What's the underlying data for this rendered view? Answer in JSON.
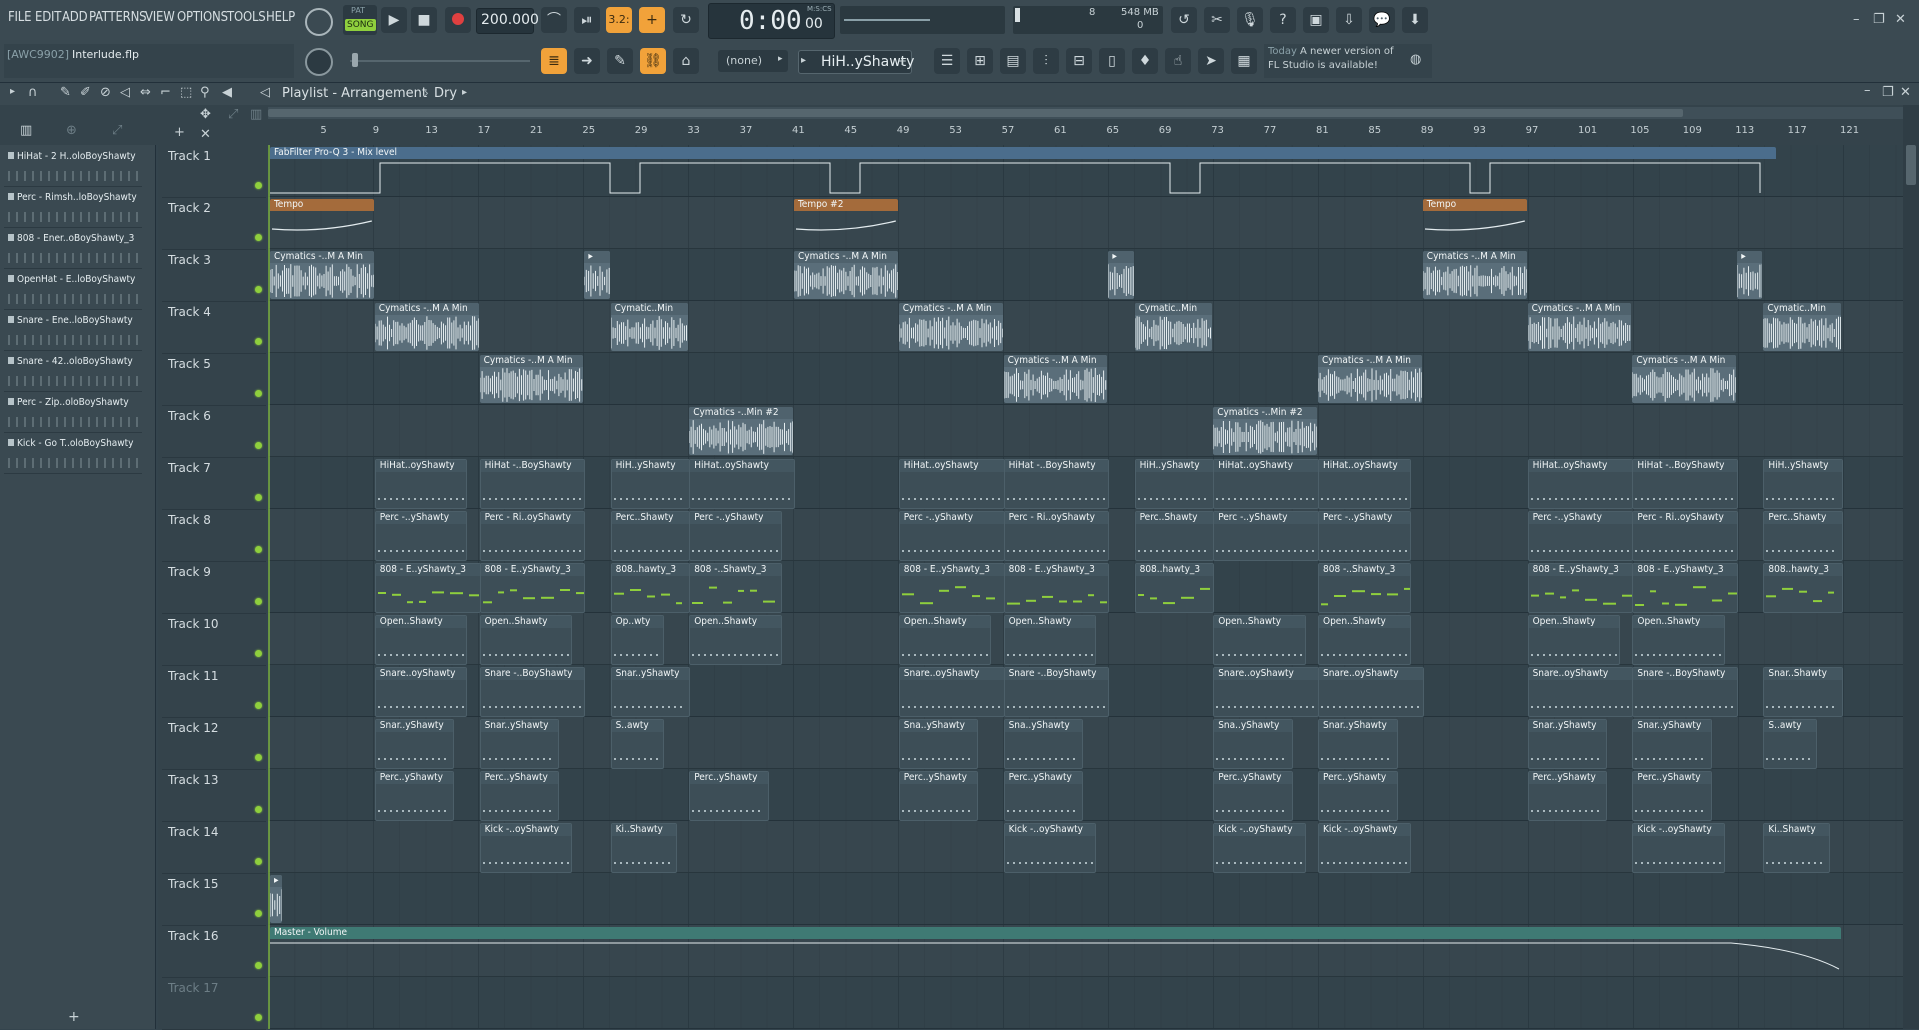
{
  "menu": [
    "FILE",
    "EDIT",
    "ADD",
    "PATTERNS",
    "VIEW",
    "OPTIONS",
    "TOOLS",
    "HELP"
  ],
  "transport": {
    "mode_top": "PAT",
    "mode": "SONG",
    "tempo": "200.000",
    "time": "0:00",
    "time_sub": "00",
    "time_label": "M:S:CS",
    "pattern_num": "3.2:",
    "cpu_value": "8",
    "mem": "548 MB",
    "voices": "0"
  },
  "project": {
    "hint": "[AWC9902]",
    "file": "Interlude.flp"
  },
  "snap": "(none)",
  "pattern_selector": "HiH..yShawty",
  "news": {
    "line1": "Today",
    "line1b": "A newer version of",
    "line2": "FL Studio is available!"
  },
  "playlist": {
    "title": "Playlist - Arrangement",
    "sep": "›",
    "sub": "Dry"
  },
  "ruler": [
    "5",
    "9",
    "13",
    "17",
    "21",
    "25",
    "29",
    "33",
    "37",
    "41",
    "45",
    "49",
    "53",
    "57",
    "61",
    "65",
    "69",
    "73",
    "77",
    "81",
    "85",
    "89",
    "93",
    "97",
    "101",
    "105",
    "109",
    "113",
    "117",
    "121"
  ],
  "picker": [
    "HiHat - 2 H..oloBoyShawty",
    "Perc - Rimsh..loBoyShawty",
    "808 - Ener..oBoyShawty_3",
    "OpenHat - E..loBoyShawty",
    "Snare - Ene..loBoyShawty",
    "Snare - 42..oloBoyShawty",
    "Perc - Zip..oloBoyShawty",
    "Kick - Go T..oloBoyShawty"
  ],
  "tracks": [
    "Track 1",
    "Track 2",
    "Track 3",
    "Track 4",
    "Track 5",
    "Track 6",
    "Track 7",
    "Track 8",
    "Track 9",
    "Track 10",
    "Track 11",
    "Track 12",
    "Track 13",
    "Track 14",
    "Track 15",
    "Track 16",
    "Track 17"
  ],
  "clips": [
    {
      "t": 0,
      "s": 0,
      "l": 115,
      "k": "auto1",
      "n": "FabFilter Pro-Q 3 - Mix level"
    },
    {
      "t": 1,
      "s": 0,
      "l": 8,
      "k": "tempo",
      "n": "Tempo"
    },
    {
      "t": 1,
      "s": 40,
      "l": 8,
      "k": "tempo",
      "n": "Tempo #2"
    },
    {
      "t": 1,
      "s": 88,
      "l": 8,
      "k": "tempo",
      "n": "Tempo"
    },
    {
      "t": 2,
      "s": 0,
      "l": 8,
      "k": "audio",
      "n": "Cymatics -..M A Min"
    },
    {
      "t": 2,
      "s": 24,
      "l": 2,
      "k": "audio",
      "n": "▸"
    },
    {
      "t": 2,
      "s": 40,
      "l": 8,
      "k": "audio",
      "n": "Cymatics -..M A Min"
    },
    {
      "t": 2,
      "s": 64,
      "l": 2,
      "k": "audio",
      "n": "▸"
    },
    {
      "t": 2,
      "s": 88,
      "l": 8,
      "k": "audio",
      "n": "Cymatics -..M A Min"
    },
    {
      "t": 2,
      "s": 112,
      "l": 2,
      "k": "audio",
      "n": "▸"
    },
    {
      "t": 3,
      "s": 8,
      "l": 8,
      "k": "audio",
      "n": "Cymatics -..M A Min"
    },
    {
      "t": 3,
      "s": 26,
      "l": 6,
      "k": "audio",
      "n": "Cymatic..Min"
    },
    {
      "t": 3,
      "s": 48,
      "l": 8,
      "k": "audio",
      "n": "Cymatics -..M A Min"
    },
    {
      "t": 3,
      "s": 66,
      "l": 6,
      "k": "audio",
      "n": "Cymatic..Min"
    },
    {
      "t": 3,
      "s": 96,
      "l": 8,
      "k": "audio",
      "n": "Cymatics -..M A Min"
    },
    {
      "t": 3,
      "s": 114,
      "l": 6,
      "k": "audio",
      "n": "Cymatic..Min"
    },
    {
      "t": 4,
      "s": 16,
      "l": 8,
      "k": "audio",
      "n": "Cymatics -..M A Min"
    },
    {
      "t": 4,
      "s": 56,
      "l": 8,
      "k": "audio",
      "n": "Cymatics -..M A Min"
    },
    {
      "t": 4,
      "s": 80,
      "l": 8,
      "k": "audio",
      "n": "Cymatics -..M A Min"
    },
    {
      "t": 4,
      "s": 104,
      "l": 8,
      "k": "audio",
      "n": "Cymatics -..M A Min"
    },
    {
      "t": 5,
      "s": 32,
      "l": 8,
      "k": "audio",
      "n": "Cymatics -..Min #2"
    },
    {
      "t": 5,
      "s": 72,
      "l": 8,
      "k": "audio",
      "n": "Cymatics -..Min #2"
    },
    {
      "t": 6,
      "s": 8,
      "l": 7,
      "k": "pat",
      "n": "HiHat..oyShawty"
    },
    {
      "t": 6,
      "s": 16,
      "l": 8,
      "k": "pat",
      "n": "HiHat -..BoyShawty"
    },
    {
      "t": 6,
      "s": 26,
      "l": 6,
      "k": "pat",
      "n": "HiH..yShawty"
    },
    {
      "t": 6,
      "s": 32,
      "l": 8,
      "k": "pat",
      "n": "HiHat..oyShawty"
    },
    {
      "t": 6,
      "s": 48,
      "l": 8,
      "k": "pat",
      "n": "HiHat..oyShawty"
    },
    {
      "t": 6,
      "s": 56,
      "l": 8,
      "k": "pat",
      "n": "HiHat -..BoyShawty"
    },
    {
      "t": 6,
      "s": 66,
      "l": 6,
      "k": "pat",
      "n": "HiH..yShawty"
    },
    {
      "t": 6,
      "s": 72,
      "l": 8,
      "k": "pat",
      "n": "HiHat..oyShawty"
    },
    {
      "t": 6,
      "s": 80,
      "l": 7,
      "k": "pat",
      "n": "HiHat..oyShawty"
    },
    {
      "t": 6,
      "s": 96,
      "l": 8,
      "k": "pat",
      "n": "HiHat..oyShawty"
    },
    {
      "t": 6,
      "s": 104,
      "l": 8,
      "k": "pat",
      "n": "HiHat -..BoyShawty"
    },
    {
      "t": 6,
      "s": 114,
      "l": 6,
      "k": "pat",
      "n": "HiH..yShawty"
    },
    {
      "t": 7,
      "s": 8,
      "l": 7,
      "k": "pat",
      "n": "Perc -..yShawty"
    },
    {
      "t": 7,
      "s": 16,
      "l": 8,
      "k": "pat",
      "n": "Perc - Ri..oyShawty"
    },
    {
      "t": 7,
      "s": 26,
      "l": 6,
      "k": "pat",
      "n": "Perc..Shawty"
    },
    {
      "t": 7,
      "s": 32,
      "l": 7,
      "k": "pat",
      "n": "Perc -..yShawty"
    },
    {
      "t": 7,
      "s": 48,
      "l": 8,
      "k": "pat",
      "n": "Perc -..yShawty"
    },
    {
      "t": 7,
      "s": 56,
      "l": 8,
      "k": "pat",
      "n": "Perc - Ri..oyShawty"
    },
    {
      "t": 7,
      "s": 66,
      "l": 6,
      "k": "pat",
      "n": "Perc..Shawty"
    },
    {
      "t": 7,
      "s": 72,
      "l": 8,
      "k": "pat",
      "n": "Perc -..yShawty"
    },
    {
      "t": 7,
      "s": 80,
      "l": 7,
      "k": "pat",
      "n": "Perc -..yShawty"
    },
    {
      "t": 7,
      "s": 96,
      "l": 8,
      "k": "pat",
      "n": "Perc -..yShawty"
    },
    {
      "t": 7,
      "s": 104,
      "l": 8,
      "k": "pat",
      "n": "Perc - Ri..oyShawty"
    },
    {
      "t": 7,
      "s": 114,
      "l": 6,
      "k": "pat",
      "n": "Perc..Shawty"
    },
    {
      "t": 8,
      "s": 8,
      "l": 8,
      "k": "pat808",
      "n": "808 - E..yShawty_3"
    },
    {
      "t": 8,
      "s": 16,
      "l": 8,
      "k": "pat808",
      "n": "808 - E..yShawty_3"
    },
    {
      "t": 8,
      "s": 26,
      "l": 6,
      "k": "pat808",
      "n": "808..hawty_3"
    },
    {
      "t": 8,
      "s": 32,
      "l": 7,
      "k": "pat808",
      "n": "808 -..Shawty_3"
    },
    {
      "t": 8,
      "s": 48,
      "l": 8,
      "k": "pat808",
      "n": "808 - E..yShawty_3"
    },
    {
      "t": 8,
      "s": 56,
      "l": 8,
      "k": "pat808",
      "n": "808 - E..yShawty_3"
    },
    {
      "t": 8,
      "s": 66,
      "l": 6,
      "k": "pat808",
      "n": "808..hawty_3"
    },
    {
      "t": 8,
      "s": 80,
      "l": 7,
      "k": "pat808",
      "n": "808 -..Shawty_3"
    },
    {
      "t": 8,
      "s": 96,
      "l": 8,
      "k": "pat808",
      "n": "808 - E..yShawty_3"
    },
    {
      "t": 8,
      "s": 104,
      "l": 8,
      "k": "pat808",
      "n": "808 - E..yShawty_3"
    },
    {
      "t": 8,
      "s": 114,
      "l": 6,
      "k": "pat808",
      "n": "808..hawty_3"
    },
    {
      "t": 9,
      "s": 8,
      "l": 7,
      "k": "pat",
      "n": "Open..Shawty"
    },
    {
      "t": 9,
      "s": 16,
      "l": 7,
      "k": "pat",
      "n": "Open..Shawty"
    },
    {
      "t": 9,
      "s": 26,
      "l": 4,
      "k": "pat",
      "n": "Op..wty"
    },
    {
      "t": 9,
      "s": 32,
      "l": 7,
      "k": "pat",
      "n": "Open..Shawty"
    },
    {
      "t": 9,
      "s": 48,
      "l": 7,
      "k": "pat",
      "n": "Open..Shawty"
    },
    {
      "t": 9,
      "s": 56,
      "l": 7,
      "k": "pat",
      "n": "Open..Shawty"
    },
    {
      "t": 9,
      "s": 72,
      "l": 7,
      "k": "pat",
      "n": "Open..Shawty"
    },
    {
      "t": 9,
      "s": 80,
      "l": 7,
      "k": "pat",
      "n": "Open..Shawty"
    },
    {
      "t": 9,
      "s": 96,
      "l": 7,
      "k": "pat",
      "n": "Open..Shawty"
    },
    {
      "t": 9,
      "s": 104,
      "l": 7,
      "k": "pat",
      "n": "Open..Shawty"
    },
    {
      "t": 10,
      "s": 8,
      "l": 7,
      "k": "pat",
      "n": "Snare..oyShawty"
    },
    {
      "t": 10,
      "s": 16,
      "l": 8,
      "k": "pat",
      "n": "Snare -..BoyShawty"
    },
    {
      "t": 10,
      "s": 26,
      "l": 6,
      "k": "pat",
      "n": "Snar..yShawty"
    },
    {
      "t": 10,
      "s": 48,
      "l": 8,
      "k": "pat",
      "n": "Snare..oyShawty"
    },
    {
      "t": 10,
      "s": 56,
      "l": 8,
      "k": "pat",
      "n": "Snare -..BoyShawty"
    },
    {
      "t": 10,
      "s": 72,
      "l": 8,
      "k": "pat",
      "n": "Snare..oyShawty"
    },
    {
      "t": 10,
      "s": 80,
      "l": 8,
      "k": "pat",
      "n": "Snare..oyShawty"
    },
    {
      "t": 10,
      "s": 96,
      "l": 8,
      "k": "pat",
      "n": "Snare..oyShawty"
    },
    {
      "t": 10,
      "s": 104,
      "l": 8,
      "k": "pat",
      "n": "Snare -..BoyShawty"
    },
    {
      "t": 10,
      "s": 114,
      "l": 6,
      "k": "pat",
      "n": "Snar..Shawty"
    },
    {
      "t": 11,
      "s": 8,
      "l": 6,
      "k": "pat",
      "n": "Snar..yShawty"
    },
    {
      "t": 11,
      "s": 16,
      "l": 6,
      "k": "pat",
      "n": "Snar..yShawty"
    },
    {
      "t": 11,
      "s": 26,
      "l": 4,
      "k": "pat",
      "n": "S..awty"
    },
    {
      "t": 11,
      "s": 48,
      "l": 6,
      "k": "pat",
      "n": "Sna..yShawty"
    },
    {
      "t": 11,
      "s": 56,
      "l": 6,
      "k": "pat",
      "n": "Sna..yShawty"
    },
    {
      "t": 11,
      "s": 72,
      "l": 6,
      "k": "pat",
      "n": "Sna..yShawty"
    },
    {
      "t": 11,
      "s": 80,
      "l": 6,
      "k": "pat",
      "n": "Snar..yShawty"
    },
    {
      "t": 11,
      "s": 96,
      "l": 6,
      "k": "pat",
      "n": "Snar..yShawty"
    },
    {
      "t": 11,
      "s": 104,
      "l": 6,
      "k": "pat",
      "n": "Snar..yShawty"
    },
    {
      "t": 11,
      "s": 114,
      "l": 4,
      "k": "pat",
      "n": "S..awty"
    },
    {
      "t": 12,
      "s": 8,
      "l": 6,
      "k": "pat",
      "n": "Perc..yShawty"
    },
    {
      "t": 12,
      "s": 16,
      "l": 6,
      "k": "pat",
      "n": "Perc..yShawty"
    },
    {
      "t": 12,
      "s": 32,
      "l": 6,
      "k": "pat",
      "n": "Perc..yShawty"
    },
    {
      "t": 12,
      "s": 48,
      "l": 6,
      "k": "pat",
      "n": "Perc..yShawty"
    },
    {
      "t": 12,
      "s": 56,
      "l": 6,
      "k": "pat",
      "n": "Perc..yShawty"
    },
    {
      "t": 12,
      "s": 72,
      "l": 6,
      "k": "pat",
      "n": "Perc..yShawty"
    },
    {
      "t": 12,
      "s": 80,
      "l": 6,
      "k": "pat",
      "n": "Perc..yShawty"
    },
    {
      "t": 12,
      "s": 96,
      "l": 6,
      "k": "pat",
      "n": "Perc..yShawty"
    },
    {
      "t": 12,
      "s": 104,
      "l": 6,
      "k": "pat",
      "n": "Perc..yShawty"
    },
    {
      "t": 13,
      "s": 16,
      "l": 7,
      "k": "pat",
      "n": "Kick -..oyShawty"
    },
    {
      "t": 13,
      "s": 26,
      "l": 5,
      "k": "pat",
      "n": "Ki..Shawty"
    },
    {
      "t": 13,
      "s": 56,
      "l": 7,
      "k": "pat",
      "n": "Kick -..oyShawty"
    },
    {
      "t": 13,
      "s": 72,
      "l": 7,
      "k": "pat",
      "n": "Kick -..oyShawty"
    },
    {
      "t": 13,
      "s": 80,
      "l": 7,
      "k": "pat",
      "n": "Kick -..oyShawty"
    },
    {
      "t": 13,
      "s": 104,
      "l": 7,
      "k": "pat",
      "n": "Kick -..oyShawty"
    },
    {
      "t": 13,
      "s": 114,
      "l": 5,
      "k": "pat",
      "n": "Ki..Shawty"
    },
    {
      "t": 14,
      "s": 0,
      "l": 1,
      "k": "audio",
      "n": "▸"
    },
    {
      "t": 15,
      "s": 0,
      "l": 120,
      "k": "auto2",
      "n": "Master - Volume"
    }
  ],
  "colors": {
    "accent": "#f1a23a",
    "led": "#8fcf3d",
    "audio": "#5a6e7a",
    "tempo": "#a46b3b",
    "automation": "#4b6d8c",
    "master": "#3f7a74"
  }
}
